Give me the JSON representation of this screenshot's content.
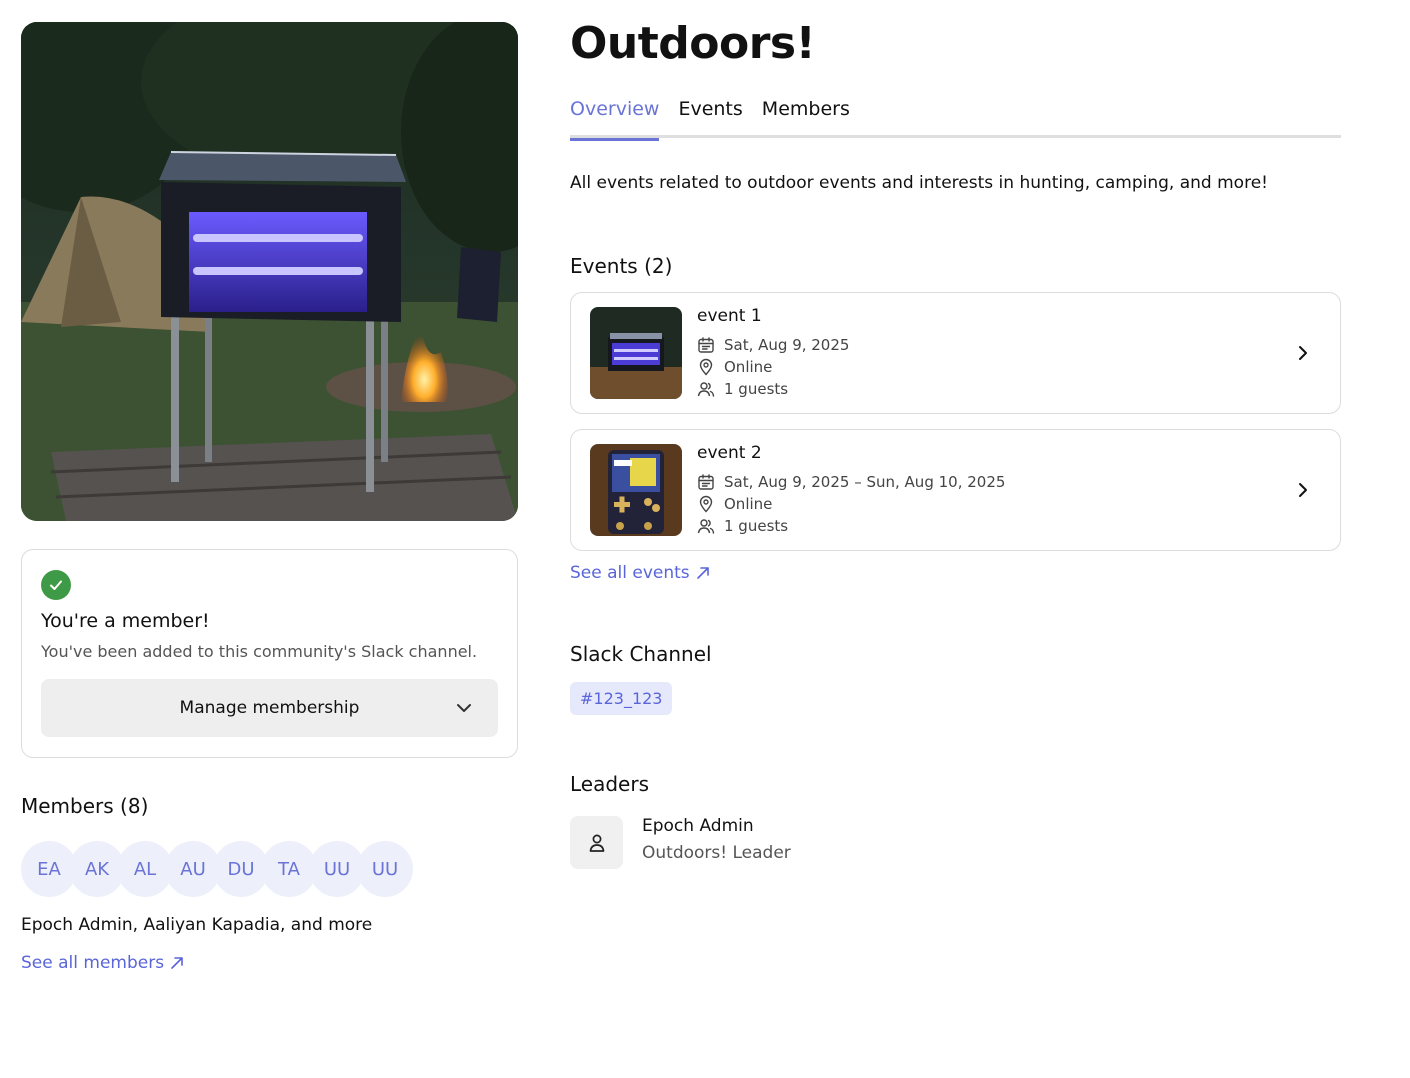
{
  "community": {
    "title": "Outdoors!",
    "description": "All events related to outdoor events and interests in hunting, camping, and more!"
  },
  "tabs": [
    {
      "label": "Overview",
      "active": true
    },
    {
      "label": "Events",
      "active": false
    },
    {
      "label": "Members",
      "active": false
    }
  ],
  "membership": {
    "title": "You're a member!",
    "subtitle": "You've been added to this community's Slack channel.",
    "manage_label": "Manage membership"
  },
  "members": {
    "heading": "Members (8)",
    "initials": [
      "EA",
      "AK",
      "AL",
      "AU",
      "DU",
      "TA",
      "UU",
      "UU"
    ],
    "summary": "Epoch Admin, Aaliyan Kapadia, and more",
    "see_all": "See all members"
  },
  "events": {
    "heading": "Events (2)",
    "items": [
      {
        "name": "event 1",
        "date": "Sat, Aug 9, 2025",
        "location": "Online",
        "guests": "1 guests"
      },
      {
        "name": "event 2",
        "date": "Sat, Aug 9, 2025 – Sun, Aug 10, 2025",
        "location": "Online",
        "guests": "1 guests"
      }
    ],
    "see_all": "See all events"
  },
  "slack": {
    "heading": "Slack Channel",
    "channel": "#123_123"
  },
  "leaders": {
    "heading": "Leaders",
    "items": [
      {
        "name": "Epoch Admin",
        "role": "Outdoors! Leader"
      }
    ]
  },
  "colors": {
    "accent": "#6a74d6",
    "link": "#5965d8",
    "success": "#3f9a47"
  }
}
